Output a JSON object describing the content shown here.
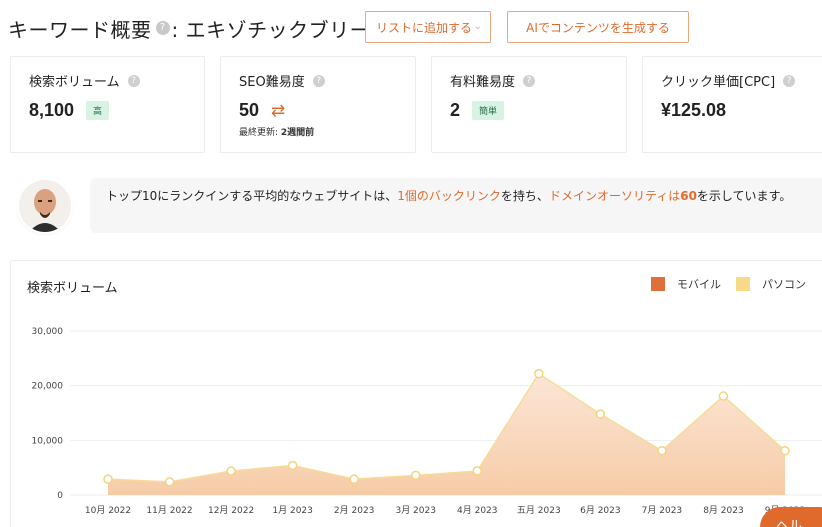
{
  "header": {
    "title_prefix": "キーワード概要",
    "help_glyph": "?",
    "title_keyword": ": エキゾチックブリー",
    "add_to_list_label": "リストに追加する",
    "ai_button_label": "AIでコンテンツを生成する"
  },
  "metrics": [
    {
      "label": "検索ボリューム",
      "value": "8,100",
      "badge": "高"
    },
    {
      "label": "SEO難易度",
      "value": "50",
      "updated_label": "最終更新: ",
      "updated_value": "2週間前"
    },
    {
      "label": "有料難易度",
      "value": "2",
      "badge": "簡単"
    },
    {
      "label": "クリック単価[CPC]",
      "value": "¥125.08"
    }
  ],
  "info": {
    "t1": "トップ10にランクインする平均的なウェブサイトは、",
    "t2": "1個のバックリンク",
    "t3": "を持ち、",
    "t4": "ドメインオーソリティは",
    "t5": "60",
    "t6": "を示しています。"
  },
  "chart_data": {
    "type": "area",
    "title": "検索ボリューム",
    "categories": [
      "10月 2022",
      "11月 2022",
      "12月 2022",
      "1月 2023",
      "2月 2023",
      "3月 2023",
      "4月 2023",
      "五月 2023",
      "6月 2023",
      "7月 2023",
      "8月 2023",
      "9月 2023"
    ],
    "series": [
      {
        "name": "モバイル",
        "color": "#e0703a",
        "values": [
          0,
          0,
          0,
          0,
          0,
          0,
          0,
          0,
          0,
          0,
          0,
          0
        ]
      },
      {
        "name": "パソコン",
        "color": "#f8d98a",
        "values": [
          2900,
          2400,
          4400,
          5400,
          2900,
          3600,
          4400,
          22200,
          14800,
          8100,
          18100,
          8100
        ]
      }
    ],
    "ylim": [
      0,
      30000
    ],
    "yticks": [
      "0",
      "10,000",
      "20,000",
      "30,000"
    ],
    "grid": true,
    "legend": "top-right"
  },
  "help_widget": {
    "label": "ヘル"
  }
}
